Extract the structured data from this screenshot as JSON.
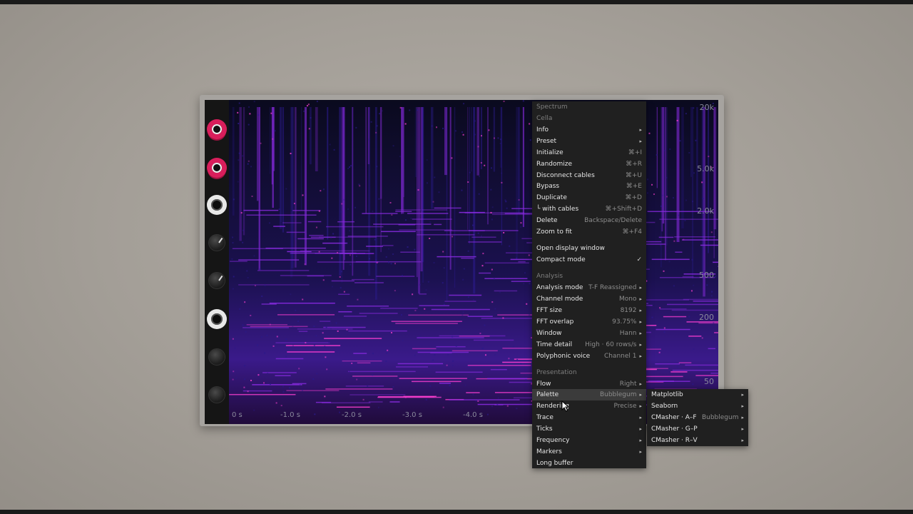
{
  "module": {
    "freq_labels": [
      "20k",
      "5.0k",
      "2.0k",
      "500",
      "200",
      "50"
    ],
    "time_labels": [
      "0 s",
      "-1.0 s",
      "-2.0 s",
      "-3.0 s",
      "-4.0 s"
    ],
    "ports": [
      "pink",
      "pink",
      "white",
      "knob",
      "knob",
      "white",
      "knob-dim",
      "knob-dim"
    ]
  },
  "menu": {
    "items": [
      {
        "label": "Spectrum",
        "type": "header"
      },
      {
        "label": "Cella",
        "type": "header"
      },
      {
        "label": "Info",
        "submenu": true
      },
      {
        "label": "Preset",
        "submenu": true
      },
      {
        "label": "Initialize",
        "shortcut": "⌘+I"
      },
      {
        "label": "Randomize",
        "shortcut": "⌘+R"
      },
      {
        "label": "Disconnect cables",
        "shortcut": "⌘+U"
      },
      {
        "label": "Bypass",
        "shortcut": "⌘+E"
      },
      {
        "label": "Duplicate",
        "shortcut": "⌘+D"
      },
      {
        "label": "└ with cables",
        "shortcut": "⌘+Shift+D"
      },
      {
        "label": "Delete",
        "shortcut": "Backspace/Delete"
      },
      {
        "label": "Zoom to fit",
        "shortcut": "⌘+F4"
      },
      {
        "label": "Open display window"
      },
      {
        "label": "Compact mode",
        "check": "✓"
      },
      {
        "label": "Analysis",
        "type": "header"
      },
      {
        "label": "Analysis mode",
        "value": "T-F Reassigned",
        "submenu": true
      },
      {
        "label": "Channel mode",
        "value": "Mono",
        "submenu": true
      },
      {
        "label": "FFT size",
        "value": "8192",
        "submenu": true
      },
      {
        "label": "FFT overlap",
        "value": "93.75%",
        "submenu": true
      },
      {
        "label": "Window",
        "value": "Hann",
        "submenu": true
      },
      {
        "label": "Time detail",
        "value": "High · 60 rows/s",
        "submenu": true
      },
      {
        "label": "Polyphonic voice",
        "value": "Channel 1",
        "submenu": true
      },
      {
        "label": "Presentation",
        "type": "header"
      },
      {
        "label": "Flow",
        "value": "Right",
        "submenu": true
      },
      {
        "label": "Palette",
        "value": "Bubblegum",
        "submenu": true,
        "active": true
      },
      {
        "label": "Rendering",
        "value": "Precise",
        "submenu": true
      },
      {
        "label": "Trace",
        "submenu": true
      },
      {
        "label": "Ticks",
        "submenu": true
      },
      {
        "label": "Frequency",
        "submenu": true
      },
      {
        "label": "Markers",
        "submenu": true
      },
      {
        "label": "Long buffer"
      }
    ],
    "arrow_glyph": "▸"
  },
  "palette_submenu": {
    "items": [
      {
        "label": "Matplotlib",
        "submenu": true
      },
      {
        "label": "Seaborn",
        "submenu": true
      },
      {
        "label": "CMasher · A–F",
        "value": "Bubblegum",
        "submenu": true
      },
      {
        "label": "CMasher · G–P",
        "submenu": true
      },
      {
        "label": "CMasher · R–V",
        "submenu": true
      }
    ]
  },
  "colors": {
    "port_pink": "#d81e5b",
    "spectrum_low": "#2a1a8a",
    "spectrum_mid": "#8a2be2",
    "spectrum_high": "#ff3fd2",
    "menu_bg": "#202020",
    "menu_active": "#3b3b3b"
  }
}
